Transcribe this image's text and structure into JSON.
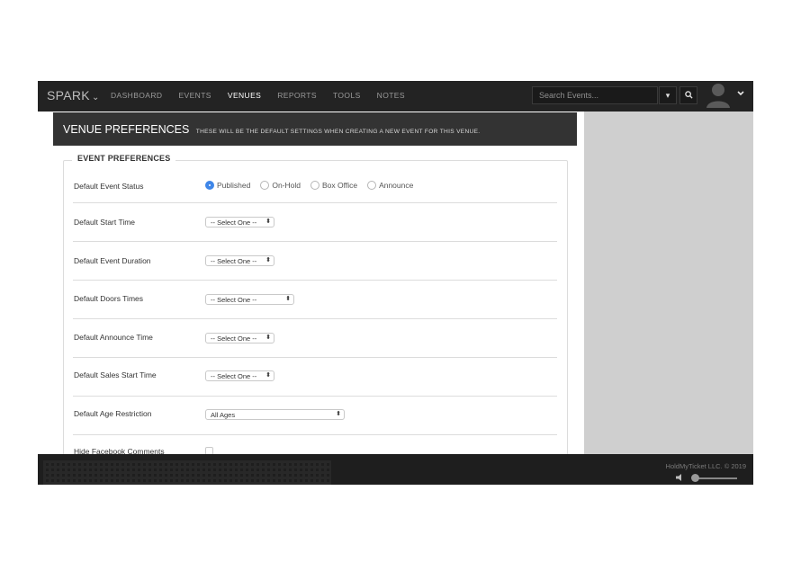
{
  "brand": {
    "name": "SPARK",
    "chevron": "⌄"
  },
  "nav": {
    "items": [
      {
        "label": "DASHBOARD",
        "active": false
      },
      {
        "label": "EVENTS",
        "active": false
      },
      {
        "label": "VENUES",
        "active": true
      },
      {
        "label": "REPORTS",
        "active": false
      },
      {
        "label": "TOOLS",
        "active": false
      },
      {
        "label": "NOTES",
        "active": false
      }
    ]
  },
  "search": {
    "placeholder": "Search Events...",
    "dropdown_icon": "caret-down-icon",
    "search_icon": "search-icon"
  },
  "user": {
    "avatar_icon": "user-avatar-icon",
    "menu_icon": "chevron-down-icon"
  },
  "header": {
    "title": "VENUE PREFERENCES",
    "subtitle": "THESE WILL BE THE DEFAULT SETTINGS WHEN CREATING A NEW EVENT FOR THIS VENUE."
  },
  "section": {
    "legend": "EVENT PREFERENCES"
  },
  "fields": {
    "status": {
      "label": "Default Event Status",
      "options": [
        {
          "label": "Published",
          "selected": true
        },
        {
          "label": "On-Hold",
          "selected": false
        },
        {
          "label": "Box Office",
          "selected": false
        },
        {
          "label": "Announce",
          "selected": false
        }
      ]
    },
    "start_time": {
      "label": "Default Start Time",
      "value": "-- Select One --"
    },
    "duration": {
      "label": "Default Event Duration",
      "value": "-- Select One --"
    },
    "doors": {
      "label": "Default Doors Times",
      "value": "-- Select One --"
    },
    "announce": {
      "label": "Default Announce Time",
      "value": "-- Select One --"
    },
    "sales_start": {
      "label": "Default Sales Start Time",
      "value": "-- Select One --"
    },
    "age": {
      "label": "Default Age Restriction",
      "value": "All Ages"
    },
    "facebook": {
      "label": "Hide Facebook Comments",
      "checked": false
    }
  },
  "footer": {
    "copyright": "HoldMyTicket LLC. © 2019",
    "volume_icon": "speaker-icon"
  },
  "colors": {
    "topbar": "#232323",
    "header": "#333333",
    "accent": "#3f86e8",
    "footer": "#1e1e1e",
    "sidebar": "#cfcfcf"
  }
}
